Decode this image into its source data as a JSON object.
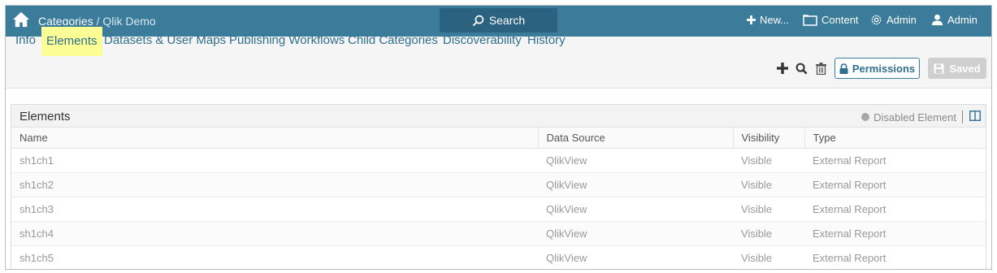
{
  "topbar": {
    "breadcrumb_root": "Categories",
    "breadcrumb_sep": " / ",
    "breadcrumb_current": "Qlik Demo",
    "search_label": "Search",
    "new_label": "New...",
    "content_label": "Content",
    "admin_label": "Admin",
    "user_label": "Admin"
  },
  "tabs": [
    {
      "label": "Info"
    },
    {
      "label": "Elements"
    },
    {
      "label": "Datasets & User Maps"
    },
    {
      "label": "Publishing Workflows"
    },
    {
      "label": "Child Categories"
    },
    {
      "label": "Discoverability"
    },
    {
      "label": "History"
    }
  ],
  "active_tab": "Elements",
  "toolbar": {
    "permissions_label": "Permissions",
    "saved_label": "Saved"
  },
  "panel": {
    "title": "Elements",
    "legend_label": "Disabled Element"
  },
  "table": {
    "columns": [
      "Name",
      "Data Source",
      "Visibility",
      "Type"
    ],
    "rows": [
      [
        "sh1ch1",
        "QlikView",
        "Visible",
        "External Report"
      ],
      [
        "sh1ch2",
        "QlikView",
        "Visible",
        "External Report"
      ],
      [
        "sh1ch3",
        "QlikView",
        "Visible",
        "External Report"
      ],
      [
        "sh1ch4",
        "QlikView",
        "Visible",
        "External Report"
      ],
      [
        "sh1ch5",
        "QlikView",
        "Visible",
        "External Report"
      ]
    ]
  },
  "colors": {
    "navbar": "#3b7c9b",
    "search_button": "#2a6280",
    "link": "#2f6f8e",
    "active_tab_highlight": "#fdfd96",
    "disabled_button": "#cfcfcf"
  }
}
